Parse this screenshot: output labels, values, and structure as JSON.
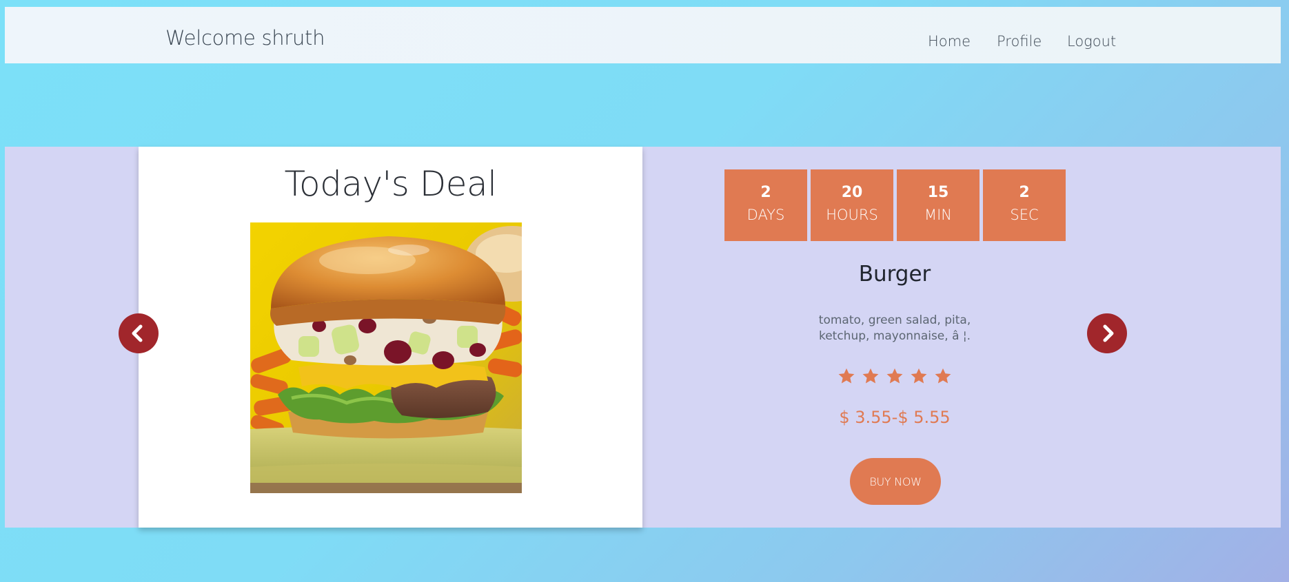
{
  "header": {
    "welcome_text": "Welcome shruth",
    "nav": {
      "home": "Home",
      "profile": "Profile",
      "logout": "Logout"
    }
  },
  "deal": {
    "title": "Today's Deal",
    "image_alt": "burger-photo",
    "countdown": [
      {
        "value": "2",
        "unit": "DAYS"
      },
      {
        "value": "20",
        "unit": "HOURS"
      },
      {
        "value": "15",
        "unit": "MIN"
      },
      {
        "value": "2",
        "unit": "SEC"
      }
    ],
    "product": {
      "name": "Burger",
      "description_line1": "tomato, green salad, pita,",
      "description_line2": "ketchup, mayonnaise, â ¦.",
      "rating": 5,
      "rating_max": 5,
      "price": "$ 3.55-$ 5.55",
      "buy_label": "BUY NOW"
    },
    "carousel": {
      "prev_icon": "chevron-left-icon",
      "next_icon": "chevron-right-icon"
    }
  },
  "colors": {
    "accent": "#e07a52",
    "arrow": "#a1262b",
    "band": "#d4d5f4",
    "nav_bg": "#eef5fb"
  }
}
